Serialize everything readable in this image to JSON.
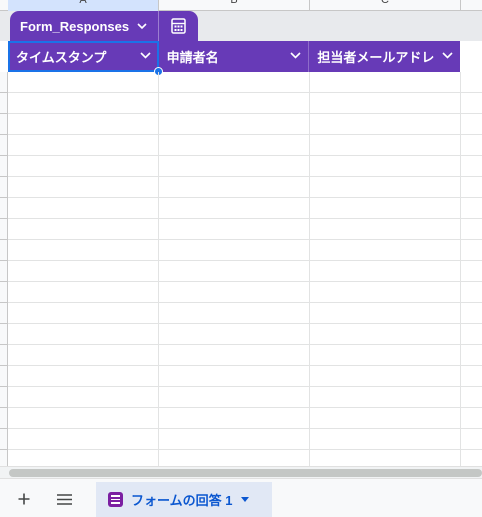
{
  "table": {
    "name": "Form_Responses",
    "accent_color": "#673ab7",
    "columns": [
      {
        "label": "タイムスタンプ",
        "selected": true
      },
      {
        "label": "申請者名",
        "selected": false
      },
      {
        "label": "担当者メールアドレ",
        "selected": false
      }
    ],
    "icons": {
      "name_dropdown": "chevron-down-icon",
      "action": "table-calculator-icon",
      "column_menu": "chevron-down-icon"
    }
  },
  "sheet_tabs": {
    "add_icon": "plus-icon",
    "all_sheets_icon": "hamburger-menu-icon",
    "active_tab": {
      "label": "フォームの回答 1",
      "icon": "form-icon",
      "color": "#0b57d0"
    }
  },
  "selection_color": "#1a73e8"
}
